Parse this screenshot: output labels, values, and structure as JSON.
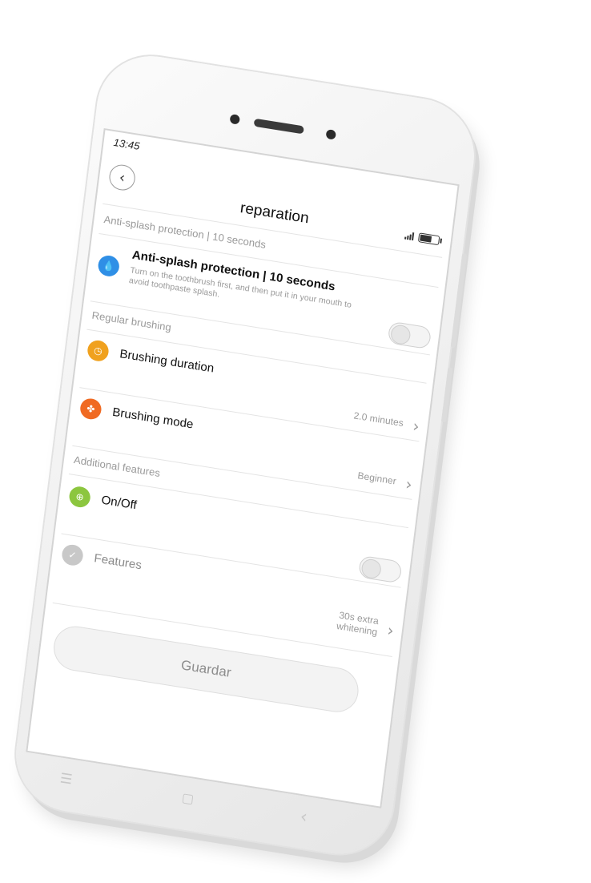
{
  "status_bar": {
    "time": "13:45"
  },
  "header": {
    "title": "reparation"
  },
  "sections": {
    "anti_splash": {
      "label": "Anti-splash protection | 10 seconds"
    },
    "regular": {
      "label": "Regular brushing"
    },
    "additional": {
      "label": "Additional features"
    }
  },
  "rows": {
    "anti_splash": {
      "title": "Anti-splash protection | 10 seconds",
      "subtitle": "Turn on the toothbrush first, and then put it in your mouth to avoid toothpaste splash.",
      "toggle_on": false
    },
    "duration": {
      "title": "Brushing duration",
      "value": "2.0 minutes"
    },
    "mode": {
      "title": "Brushing mode",
      "value": "Beginner"
    },
    "onoff": {
      "title": "On/Off",
      "toggle_on": false
    },
    "features": {
      "title": "Features",
      "value_line1": "30s extra",
      "value_line2": "whitening"
    }
  },
  "save_button": {
    "label": "Guardar"
  },
  "colors": {
    "anti_splash_icon": "#2f8fe6",
    "duration_icon": "#f0a11e",
    "mode_icon": "#f06a22",
    "onoff_icon": "#8cc63f",
    "features_icon": "#c8c8c8"
  }
}
